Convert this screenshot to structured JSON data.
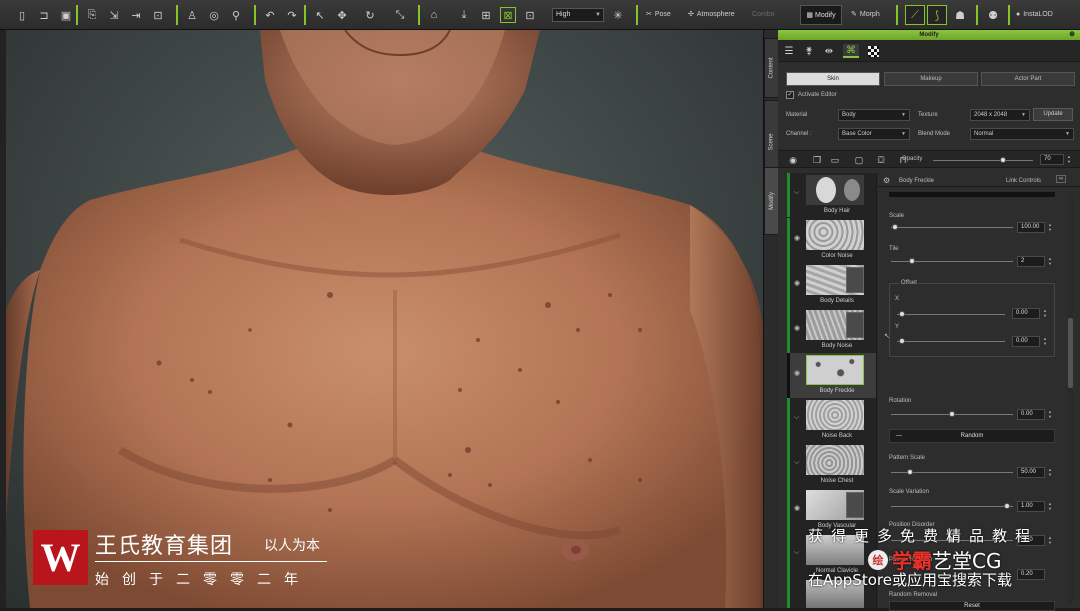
{
  "toolbar": {
    "quality_value": "High",
    "pose_label": "Pose",
    "atmosphere_label": "Atmosphere",
    "combo_label": "Combo",
    "modify_label": "Modify",
    "morph_label": "Morph",
    "instaloD_label": "InstaLOD",
    "accent_color": "#86c42b"
  },
  "side_tabs": [
    "Content",
    "Scene",
    "Modify"
  ],
  "panel": {
    "title": "Modify",
    "tabs": [
      "Skin",
      "Makeup",
      "Actor Part"
    ],
    "active_tab": "Skin",
    "activate_editor_label": "Activate Editor",
    "activate_editor_checked": "✓",
    "material_label": "Material",
    "material_value": "Body",
    "texture_label": "Texture",
    "texture_value": "2048 x 2048",
    "update_label": "Update",
    "channel_label": "Channel :",
    "channel_value": "Base Color",
    "blend_label": "Blend Mode",
    "blend_value": "Normal",
    "opacity_label": "Opacity",
    "opacity_value": "70"
  },
  "layers": [
    {
      "label": "Body Hair"
    },
    {
      "label": "Color Noise"
    },
    {
      "label": "Body Details"
    },
    {
      "label": "Body Noise"
    },
    {
      "label": "Body Freckle"
    },
    {
      "label": "Noise Back"
    },
    {
      "label": "Noise Chest"
    },
    {
      "label": "Body Vascular"
    },
    {
      "label": "Normal Clavicle"
    }
  ],
  "detail": {
    "layer_name": "Body Freckle",
    "link_controls_label": "Link Controls",
    "scale_label": "Scale",
    "scale_value": "100.00",
    "tile_label": "Tile",
    "tile_value": "2",
    "offset_label": "Offset",
    "x_label": "X",
    "x_value": "0.00",
    "y_label": "Y",
    "y_value": "0.00",
    "rotation_label": "Rotation",
    "rotation_value": "0.00",
    "random_label": "Random",
    "pattern_scale_label": "Pattern Scale",
    "pattern_scale_value": "50.00",
    "scale_variation_label": "Scale Variation",
    "scale_variation_value": "1.00",
    "position_disorder_label": "Position Disorder",
    "position_disorder_value": "0.50",
    "pattern_rotation_label": "Pattern Rotation",
    "pattern_rotation_value": "0.20",
    "random_removal_label": "Random Removal",
    "reset_label": "Reset"
  },
  "watermark": {
    "logo_letter": "W",
    "company": "王氏教育集团",
    "motto": "以人为本",
    "founded": "始创于二零零二年",
    "ad_line1": "获得更多免费精品教程",
    "ad_line2": "在AppStore或应用宝搜索下载",
    "brand_icon": "绘",
    "brand_red": "学霸",
    "brand_white": "艺堂CG"
  }
}
